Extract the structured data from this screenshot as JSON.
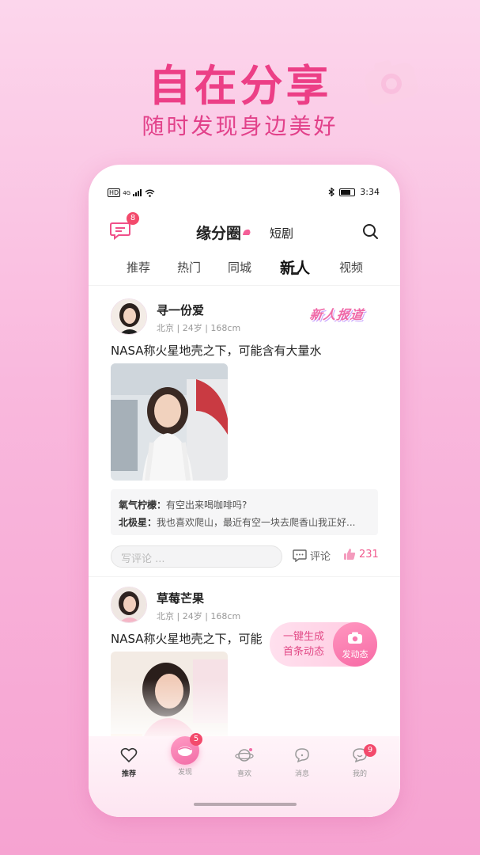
{
  "promo": {
    "headline": "自在分享",
    "subline": "随时发现身边美好"
  },
  "status_bar": {
    "left_indicator": "HD",
    "network": "4G",
    "time": "3:34"
  },
  "header": {
    "message_badge": "8",
    "title": "缘分圈",
    "short_drama": "短剧"
  },
  "tabs": [
    {
      "label": "推荐"
    },
    {
      "label": "热门"
    },
    {
      "label": "同城"
    },
    {
      "label": "新人",
      "active": true
    },
    {
      "label": "视频"
    }
  ],
  "posts": [
    {
      "name": "寻一份爱",
      "meta": "北京 | 24岁 | 168cm",
      "tag": "新人报道",
      "text": "NASA称火星地壳之下，可能含有大量水",
      "comments": [
        {
          "who": "氧气柠檬：",
          "text": "有空出来喝咖啡吗?"
        },
        {
          "who": "北极星：",
          "text": "我也喜欢爬山，最近有空一块去爬香山我正好..."
        }
      ],
      "comment_placeholder": "写评论 ...",
      "comment_label": "评论",
      "likes": "231"
    },
    {
      "name": "草莓芒果",
      "meta": "北京 | 24岁 | 168cm",
      "text": "NASA称火星地壳之下，可能"
    }
  ],
  "fab": {
    "line1": "一键生成",
    "line2": "首条动态",
    "button_label": "发动态"
  },
  "bottom_nav": [
    {
      "label": "推荐",
      "icon": "heart-icon",
      "active": true
    },
    {
      "label": "发现",
      "icon": "discover-icon",
      "badge": "5"
    },
    {
      "label": "喜欢",
      "icon": "planet-icon"
    },
    {
      "label": "消息",
      "icon": "chat-bubble-icon"
    },
    {
      "label": "我的",
      "icon": "profile-icon",
      "badge": "9"
    }
  ],
  "colors": {
    "accent": "#ec3f86",
    "badge": "#f34a6c",
    "like": "#f05a8e"
  }
}
